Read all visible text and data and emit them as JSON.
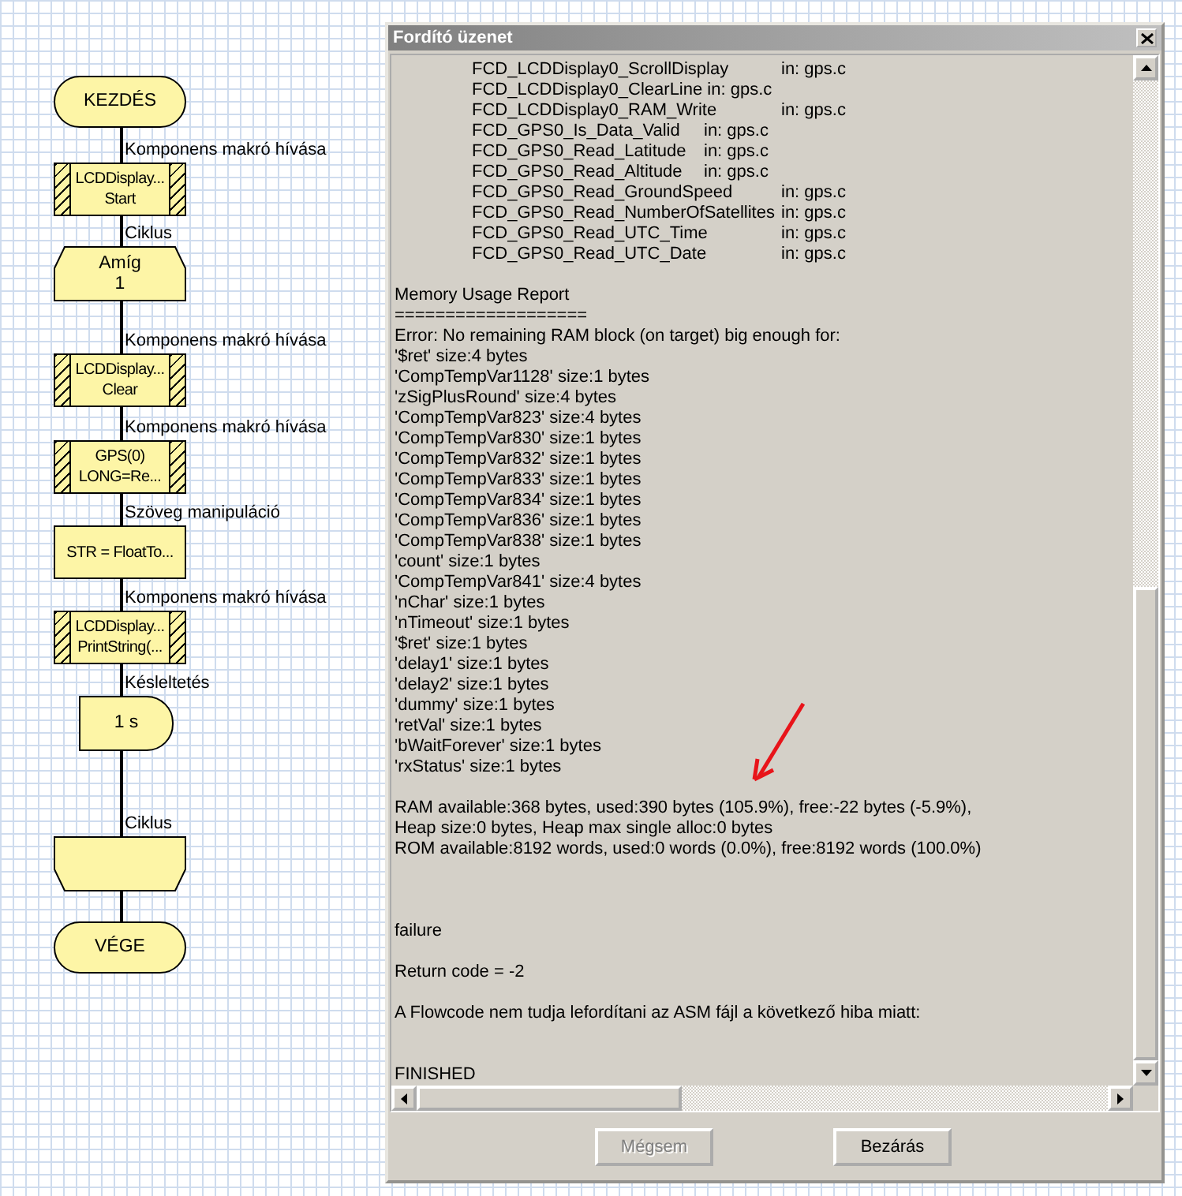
{
  "flowchart": {
    "nodes": [
      {
        "kind": "terminal",
        "lines": [
          "KEZDÉS"
        ]
      },
      {
        "kind": "macro",
        "label": "Komponens makró hívása",
        "lines": [
          "LCDDisplay...",
          "Start"
        ]
      },
      {
        "kind": "loop_start",
        "label": "Ciklus",
        "lines": [
          "Amíg",
          "1"
        ]
      },
      {
        "kind": "macro",
        "label": "Komponens makró hívása",
        "lines": [
          "LCDDisplay...",
          "Clear"
        ]
      },
      {
        "kind": "macro",
        "label": "Komponens makró hívása",
        "lines": [
          "GPS(0)",
          "LONG=Re..."
        ]
      },
      {
        "kind": "process",
        "label": "Szöveg manipuláció",
        "lines": [
          "STR = FloatTo..."
        ]
      },
      {
        "kind": "macro",
        "label": "Komponens makró hívása",
        "lines": [
          "LCDDisplay...",
          "PrintString(..."
        ]
      },
      {
        "kind": "delay",
        "label": "Késleltetés",
        "lines": [
          "1 s"
        ]
      },
      {
        "kind": "loop_end",
        "label": "Ciklus"
      },
      {
        "kind": "terminal",
        "lines": [
          "VÉGE"
        ]
      }
    ]
  },
  "dialog": {
    "title": "Fordító üzenet",
    "log": [
      {
        "kind": "text",
        "text": "\tFCD_LCDDisplay0_ScrollDisplay\tin: gps.c"
      },
      {
        "kind": "text",
        "text": "\tFCD_LCDDisplay0_ClearLine in: gps.c"
      },
      {
        "kind": "text",
        "text": "\tFCD_LCDDisplay0_RAM_Write\tin: gps.c"
      },
      {
        "kind": "text",
        "text": "\tFCD_GPS0_Is_Data_Valid\tin: gps.c"
      },
      {
        "kind": "text",
        "text": "\tFCD_GPS0_Read_Latitude\tin: gps.c"
      },
      {
        "kind": "text",
        "text": "\tFCD_GPS0_Read_Altitude\tin: gps.c"
      },
      {
        "kind": "text",
        "text": "\tFCD_GPS0_Read_GroundSpeed\tin: gps.c"
      },
      {
        "kind": "text",
        "text": "\tFCD_GPS0_Read_NumberOfSatellites\tin: gps.c"
      },
      {
        "kind": "text",
        "text": "\tFCD_GPS0_Read_UTC_Time\tin: gps.c"
      },
      {
        "kind": "text",
        "text": "\tFCD_GPS0_Read_UTC_Date\tin: gps.c"
      },
      {
        "kind": "blank"
      },
      {
        "kind": "text",
        "text": "Memory Usage Report"
      },
      {
        "kind": "text",
        "text": "==================="
      },
      {
        "kind": "text",
        "text": "Error: No remaining RAM block (on target) big enough for:"
      },
      {
        "kind": "text",
        "text": "'$ret' size:4 bytes"
      },
      {
        "kind": "text",
        "text": "'CompTempVar1128' size:1 bytes"
      },
      {
        "kind": "text",
        "text": "'zSigPlusRound' size:4 bytes"
      },
      {
        "kind": "text",
        "text": "'CompTempVar823' size:4 bytes"
      },
      {
        "kind": "text",
        "text": "'CompTempVar830' size:1 bytes"
      },
      {
        "kind": "text",
        "text": "'CompTempVar832' size:1 bytes"
      },
      {
        "kind": "text",
        "text": "'CompTempVar833' size:1 bytes"
      },
      {
        "kind": "text",
        "text": "'CompTempVar834' size:1 bytes"
      },
      {
        "kind": "text",
        "text": "'CompTempVar836' size:1 bytes"
      },
      {
        "kind": "text",
        "text": "'CompTempVar838' size:1 bytes"
      },
      {
        "kind": "text",
        "text": "'count' size:1 bytes"
      },
      {
        "kind": "text",
        "text": "'CompTempVar841' size:4 bytes"
      },
      {
        "kind": "text",
        "text": "'nChar' size:1 bytes"
      },
      {
        "kind": "text",
        "text": "'nTimeout' size:1 bytes"
      },
      {
        "kind": "text",
        "text": "'$ret' size:1 bytes"
      },
      {
        "kind": "text",
        "text": "'delay1' size:1 bytes"
      },
      {
        "kind": "text",
        "text": "'delay2' size:1 bytes"
      },
      {
        "kind": "text",
        "text": "'dummy' size:1 bytes"
      },
      {
        "kind": "text",
        "text": "'retVal' size:1 bytes"
      },
      {
        "kind": "text",
        "text": "'bWaitForever' size:1 bytes"
      },
      {
        "kind": "text",
        "text": "'rxStatus' size:1 bytes"
      },
      {
        "kind": "blank"
      },
      {
        "kind": "text",
        "text": "RAM available:368 bytes, used:390 bytes (105.9%), free:-22 bytes (-5.9%),"
      },
      {
        "kind": "text",
        "text": "Heap size:0 bytes, Heap max single alloc:0 bytes"
      },
      {
        "kind": "text",
        "text": "ROM available:8192 words, used:0 words (0.0%), free:8192 words (100.0%)"
      },
      {
        "kind": "blank"
      },
      {
        "kind": "blank"
      },
      {
        "kind": "blank"
      },
      {
        "kind": "text",
        "text": "failure"
      },
      {
        "kind": "blank"
      },
      {
        "kind": "text",
        "text": "Return code = -2"
      },
      {
        "kind": "blank"
      },
      {
        "kind": "text",
        "text": "A Flowcode nem tudja lefordítani az ASM fájl a következő hiba miatt:"
      },
      {
        "kind": "blank"
      },
      {
        "kind": "blank"
      },
      {
        "kind": "text",
        "text": "FINISHED"
      }
    ],
    "buttons": [
      {
        "label": "Mégsem",
        "disabled": true
      },
      {
        "label": "Bezárás",
        "disabled": false
      }
    ]
  }
}
